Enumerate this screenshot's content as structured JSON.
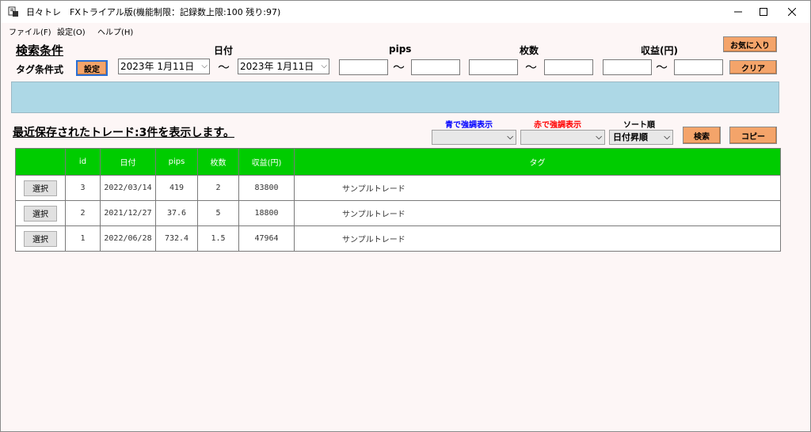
{
  "window": {
    "title": "日々トレ　FXトライアル版(機能制限：記録数上限:100 残り:97)"
  },
  "menu": [
    "ファイル(F)",
    "設定(O)",
    "ヘルプ(H)"
  ],
  "search": {
    "heading": "検索条件",
    "tag_condition_label": "タグ条件式",
    "settings_button": "設定",
    "date_label": "日付",
    "date_from": "2023年  1月11日",
    "date_to": "2023年  1月11日",
    "tilde": "〜",
    "pips_label": "pips",
    "lots_label": "枚数",
    "profit_label": "収益(円)",
    "favorite_button": "お気に入り",
    "clear_button": "クリア"
  },
  "results": {
    "label": "最近保存されたトレード:3件を表示します。",
    "blue_highlight_label": "青で強調表示",
    "red_highlight_label": "赤で強調表示",
    "sort_label": "ソート順",
    "sort_value": "日付昇順",
    "search_button": "検索",
    "copy_button": "コピー"
  },
  "colors": {
    "blue_highlight": "#0000ff",
    "red_highlight": "#ff0000",
    "header_green": "#00cc00",
    "button_orange": "#f4a46a",
    "band_blue": "#add8e6"
  },
  "table": {
    "columns": [
      "",
      "id",
      "日付",
      "pips",
      "枚数",
      "収益(円)",
      "タグ"
    ],
    "select_label": "選択",
    "rows": [
      {
        "id": "3",
        "date": "2022/03/14",
        "pips": "419",
        "lots": "2",
        "profit": "83800",
        "tag": "サンプルトレード"
      },
      {
        "id": "2",
        "date": "2021/12/27",
        "pips": "37.6",
        "lots": "5",
        "profit": "18800",
        "tag": "サンプルトレード"
      },
      {
        "id": "1",
        "date": "2022/06/28",
        "pips": "732.4",
        "lots": "1.5",
        "profit": "47964",
        "tag": "サンプルトレード"
      }
    ]
  }
}
